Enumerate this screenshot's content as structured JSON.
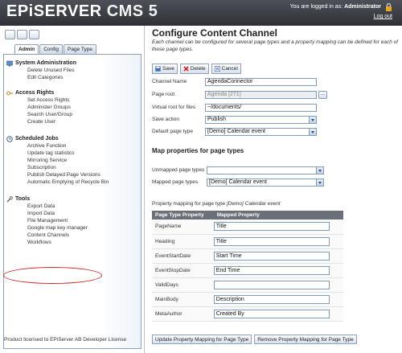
{
  "header": {
    "logo_main": "EPiSERVER",
    "logo_sub": "CMS 5",
    "logged_in_label": "You are logged in as:",
    "user": "Administrator",
    "logout": "Log out"
  },
  "left": {
    "toolbar_icons": [
      "edit-mode-icon",
      "view-mode-icon",
      "help-icon"
    ],
    "tabs": [
      "Admin",
      "Config",
      "Page Type"
    ],
    "groups": [
      {
        "title": "System Administration",
        "icon": "system-admin-icon",
        "items": [
          "Delete Unused Files",
          "Edit Categories"
        ]
      },
      {
        "title": "Access Rights",
        "icon": "access-rights-icon",
        "items": [
          "Set Access Rights",
          "Administer Groups",
          "Search User/Group",
          "Create User"
        ]
      },
      {
        "title": "Scheduled Jobs",
        "icon": "scheduled-jobs-icon",
        "items": [
          "Archive Function",
          "Update tag statistics",
          "Mirroring Service",
          "Subscription",
          "Publish Delayed Page Versions",
          "Automatic Emptying of Recycle Bin"
        ]
      },
      {
        "title": "Tools",
        "icon": "tools-icon",
        "items": [
          "Export Data",
          "Import Data",
          "File Management",
          "Google map key manager",
          "Content Channels",
          "Workflows"
        ]
      }
    ],
    "licensed": "Product licensed to EPiServer AB Developer License"
  },
  "main": {
    "title": "Configure Content Channel",
    "description": "Each channel can be configured for several page types and a property mapping can be defined for each of these page types.",
    "buttons": {
      "save": "Save",
      "delete": "Delete",
      "cancel": "Cancel"
    },
    "form": {
      "channel_name_label": "Channel Name",
      "channel_name_value": "AgendaConnector",
      "page_root_label": "Page root",
      "page_root_value": "Agenda [271]",
      "browse_label": "...",
      "virtual_root_label": "Virtual root for files",
      "virtual_root_value": "~/documents/",
      "save_action_label": "Save action",
      "save_action_value": "Publish",
      "default_page_type_label": "Default page type",
      "default_page_type_value": "[Demo] Calendar event"
    },
    "map_heading": "Map properties for page types",
    "unmapped_label": "Unmapped page types",
    "unmapped_value": "",
    "mapped_label": "Mapped page types",
    "mapped_value": "[Demo] Calendar event",
    "mapping_note_prefix": "Property mapping for page type",
    "mapping_note_type": "[Demo] Calendar event",
    "table": {
      "headers": [
        "Page Type Property",
        "Mapped Property"
      ],
      "rows": [
        {
          "property": "PageName",
          "mapped": "Title"
        },
        {
          "property": "Heading",
          "mapped": "Title"
        },
        {
          "property": "EventStartDate",
          "mapped": "Start Time"
        },
        {
          "property": "EventStopDate",
          "mapped": "End Time"
        },
        {
          "property": "ValidDays",
          "mapped": ""
        },
        {
          "property": "MainBody",
          "mapped": "Description"
        },
        {
          "property": "MetaAuthor",
          "mapped": "Created By"
        }
      ]
    },
    "update_button": "Update Property Mapping for Page Type",
    "remove_button": "Remove Property Mapping for Page Type"
  },
  "colors": {
    "header_bg": "#3a3d43",
    "table_header_bg": "#6b6f78",
    "highlight_circle": "#d2231c",
    "border_blue": "#8d9fbc"
  }
}
